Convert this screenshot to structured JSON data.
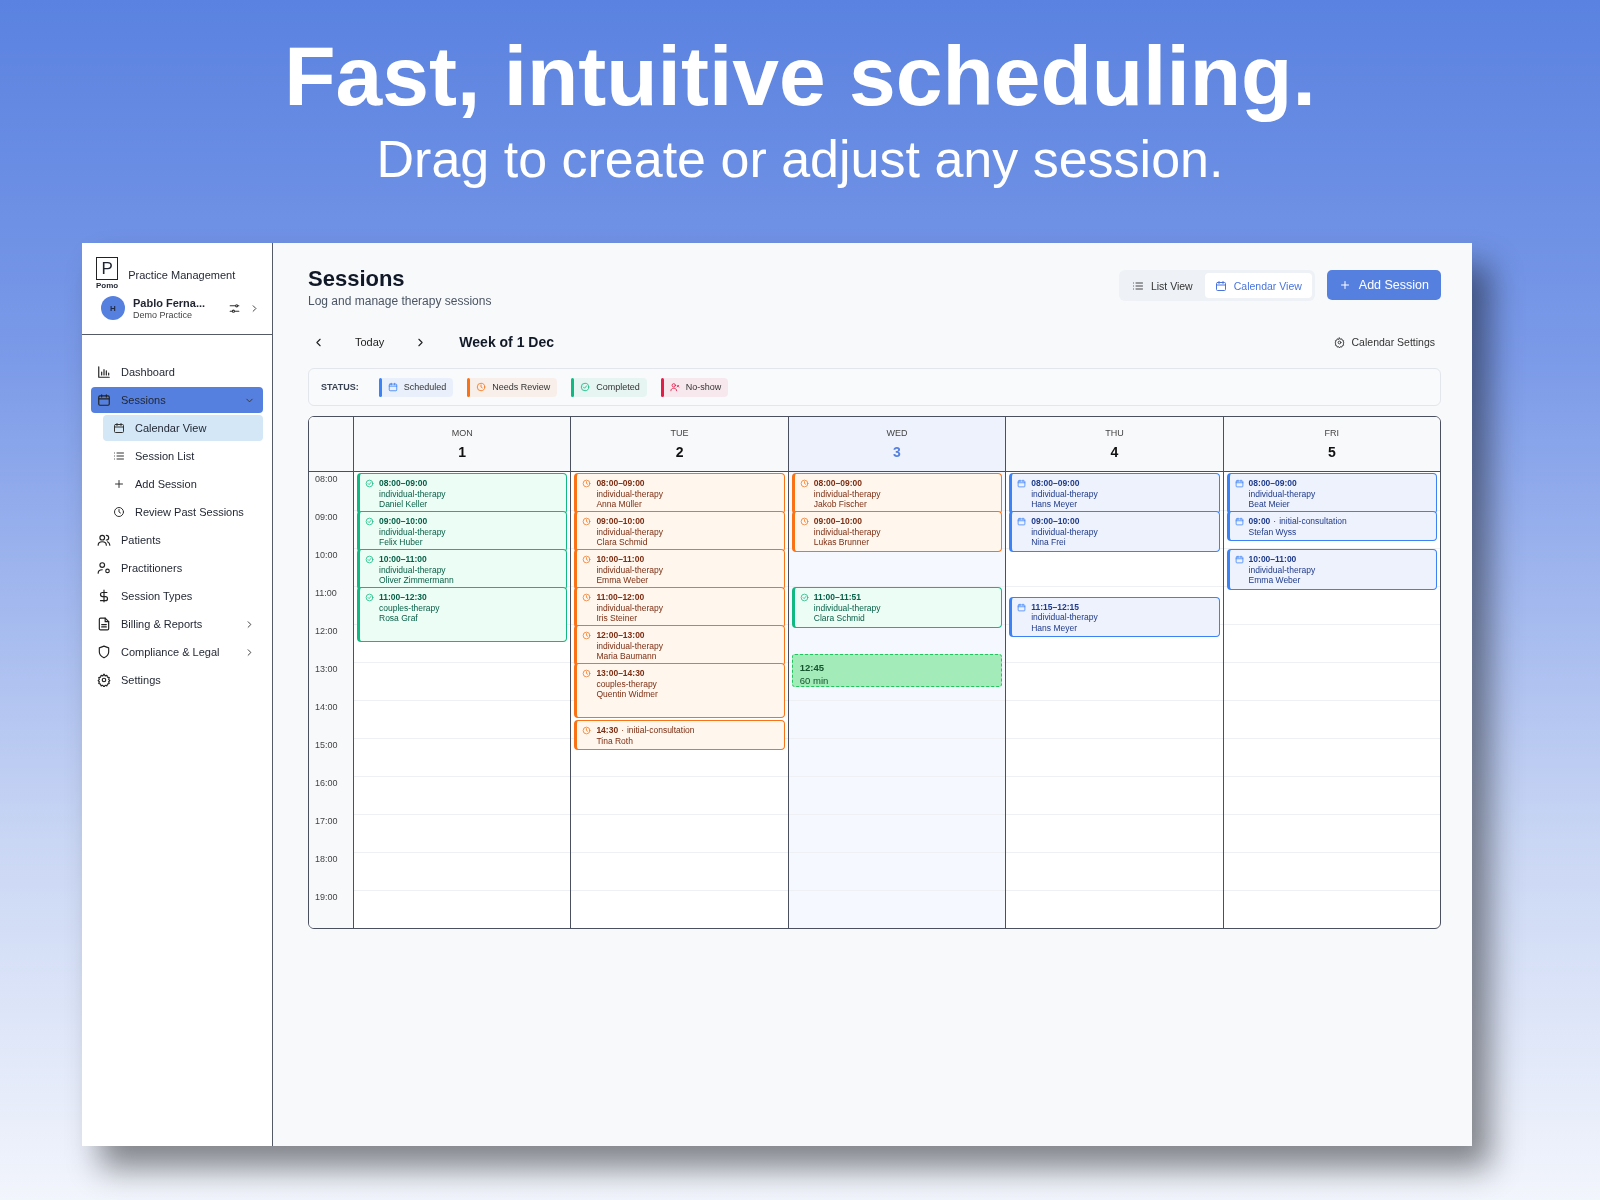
{
  "hero": {
    "title": "Fast, intuitive scheduling.",
    "subtitle": "Drag to create or adjust any session."
  },
  "sidebar": {
    "logo": {
      "letter": "P",
      "name": "Pomo"
    },
    "app_name": "Practice Management",
    "user": {
      "initial": "H",
      "name": "Pablo Ferna...",
      "practice": "Demo Practice"
    },
    "items": [
      {
        "label": "Dashboard",
        "selected": false
      },
      {
        "label": "Sessions",
        "selected": true,
        "expanded": true,
        "children": [
          {
            "label": "Calendar View",
            "selected": true
          },
          {
            "label": "Session List",
            "selected": false
          },
          {
            "label": "Add Session",
            "selected": false
          },
          {
            "label": "Review Past Sessions",
            "selected": false
          }
        ]
      },
      {
        "label": "Patients",
        "selected": false
      },
      {
        "label": "Practitioners",
        "selected": false
      },
      {
        "label": "Session Types",
        "selected": false
      },
      {
        "label": "Billing & Reports",
        "selected": false,
        "expanded": false
      },
      {
        "label": "Compliance & Legal",
        "selected": false,
        "expanded": false
      },
      {
        "label": "Settings",
        "selected": false
      }
    ]
  },
  "header": {
    "title": "Sessions",
    "subtitle": "Log and manage therapy sessions",
    "views": [
      {
        "label": "List View",
        "selected": false
      },
      {
        "label": "Calendar View",
        "selected": true
      }
    ],
    "add_button": "Add Session"
  },
  "week_nav": {
    "today": "Today",
    "week": "Week of 1 Dec",
    "settings": "Calendar Settings"
  },
  "legend": {
    "label": "STATUS:",
    "items": [
      {
        "label": "Scheduled",
        "color": "#3b82f6"
      },
      {
        "label": "Needs Review",
        "color": "#f97316"
      },
      {
        "label": "Completed",
        "color": "#10b981"
      },
      {
        "label": "No-show",
        "color": "#e11d48"
      }
    ]
  },
  "calendar": {
    "hours": [
      "08:00",
      "09:00",
      "10:00",
      "11:00",
      "12:00",
      "13:00",
      "14:00",
      "15:00",
      "16:00",
      "17:00",
      "18:00",
      "19:00"
    ],
    "days": [
      {
        "weekday": "MON",
        "date": "1",
        "today": false,
        "events": [
          {
            "kind": "range",
            "color": "#10b981",
            "time": "08:00–09:00",
            "type": "individual-therapy",
            "patient": "Daniel Keller"
          },
          {
            "kind": "range",
            "color": "#10b981",
            "time": "09:00–10:00",
            "type": "individual-therapy",
            "patient": "Felix Huber"
          },
          {
            "kind": "range",
            "color": "#10b981",
            "time": "10:00–11:00",
            "type": "individual-therapy",
            "patient": "Oliver Zimmermann"
          },
          {
            "kind": "range",
            "color": "#10b981",
            "time": "11:00–12:30",
            "type": "couples-therapy",
            "patient": "Rosa Graf"
          }
        ]
      },
      {
        "weekday": "TUE",
        "date": "2",
        "today": false,
        "events": [
          {
            "kind": "range",
            "color": "#f97316",
            "time": "08:00–09:00",
            "type": "individual-therapy",
            "patient": "Anna Müller"
          },
          {
            "kind": "range",
            "color": "#f97316",
            "time": "09:00–10:00",
            "type": "individual-therapy",
            "patient": "Clara Schmid"
          },
          {
            "kind": "range",
            "color": "#f97316",
            "time": "10:00–11:00",
            "type": "individual-therapy",
            "patient": "Emma Weber"
          },
          {
            "kind": "range",
            "color": "#f97316",
            "time": "11:00–12:00",
            "type": "individual-therapy",
            "patient": "Iris Steiner"
          },
          {
            "kind": "range",
            "color": "#f97316",
            "time": "12:00–13:00",
            "type": "individual-therapy",
            "patient": "Maria Baumann"
          },
          {
            "kind": "range",
            "color": "#f97316",
            "time": "13:00–14:30",
            "type": "couples-therapy",
            "patient": "Quentin Widmer"
          },
          {
            "kind": "point",
            "color": "#f97316",
            "time": "14:30",
            "separator": "·",
            "type": "initial-consultation",
            "patient": "Tina Roth"
          }
        ]
      },
      {
        "weekday": "WED",
        "date": "3",
        "today": true,
        "events": [
          {
            "kind": "range",
            "color": "#f97316",
            "time": "08:00–09:00",
            "type": "individual-therapy",
            "patient": "Jakob Fischer"
          },
          {
            "kind": "range",
            "color": "#f97316",
            "time": "09:00–10:00",
            "type": "individual-therapy",
            "patient": "Lukas Brunner"
          },
          {
            "kind": "range",
            "color": "#10b981",
            "time": "11:00–11:51",
            "type": "individual-therapy",
            "patient": "Clara Schmid"
          }
        ],
        "draft": {
          "time": "12:45",
          "duration": "60 min"
        }
      },
      {
        "weekday": "THU",
        "date": "4",
        "today": false,
        "events": [
          {
            "kind": "range",
            "color": "#3b82f6",
            "time": "08:00–09:00",
            "type": "individual-therapy",
            "patient": "Hans Meyer"
          },
          {
            "kind": "range",
            "color": "#3b82f6",
            "time": "09:00–10:00",
            "type": "individual-therapy",
            "patient": "Nina Frei"
          },
          {
            "kind": "range",
            "color": "#3b82f6",
            "time": "11:15–12:15",
            "type": "individual-therapy",
            "patient": "Hans Meyer"
          }
        ]
      },
      {
        "weekday": "FRI",
        "date": "5",
        "today": false,
        "events": [
          {
            "kind": "range",
            "color": "#3b82f6",
            "time": "08:00–09:00",
            "type": "individual-therapy",
            "patient": "Beat Meier"
          },
          {
            "kind": "point",
            "color": "#3b82f6",
            "time": "09:00",
            "separator": "·",
            "type": "initial-consultation",
            "patient": "Stefan Wyss"
          },
          {
            "kind": "range",
            "color": "#3b82f6",
            "time": "10:00–11:00",
            "type": "individual-therapy",
            "patient": "Emma Weber"
          }
        ]
      }
    ]
  }
}
